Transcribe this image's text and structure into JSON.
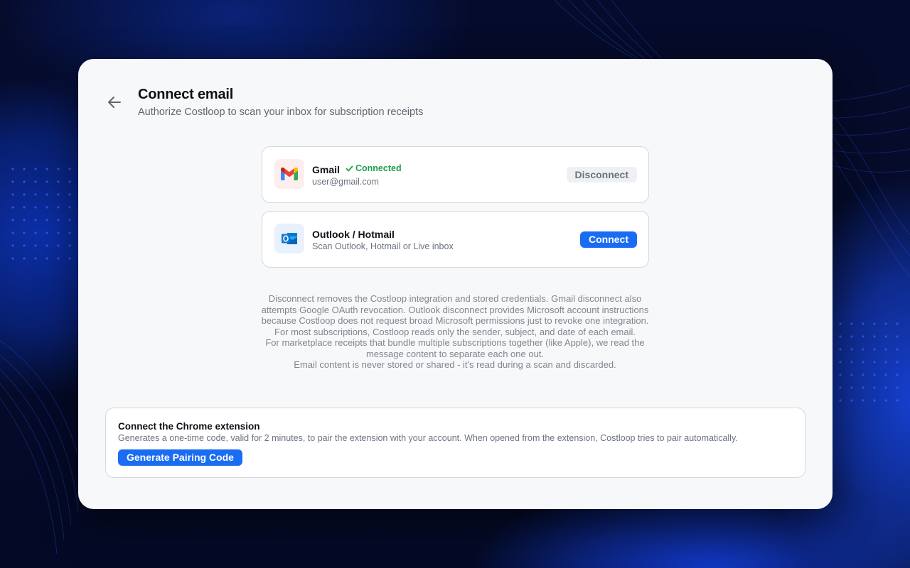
{
  "page": {
    "title": "Connect email",
    "subtitle": "Authorize Costloop to scan your inbox for subscription receipts",
    "back_icon": "arrow-left-icon"
  },
  "providers": [
    {
      "name": "Gmail",
      "icon": "gmail-icon",
      "status": "Connected",
      "status_color": "#1e9e4a",
      "subtext": "user@gmail.com",
      "action": "Disconnect"
    },
    {
      "name": "Outlook / Hotmail",
      "icon": "outlook-icon",
      "subtext": "Scan Outlook, Hotmail or Live inbox",
      "action": "Connect"
    }
  ],
  "disclaimer": [
    "Disconnect removes the Costloop integration and stored credentials. Gmail disconnect also attempts Google OAuth revocation. Outlook disconnect provides Microsoft account instructions because Costloop does not request broad Microsoft permissions just to revoke one integration.",
    "For most subscriptions, Costloop reads only the sender, subject, and date of each email.",
    "For marketplace receipts that bundle multiple subscriptions together (like Apple), we read the message content to separate each one out.",
    "Email content is never stored or shared - it's read during a scan and discarded."
  ],
  "extension": {
    "title": "Connect the Chrome extension",
    "description": "Generates a one-time code, valid for 2 minutes, to pair the extension with your account. When opened from the extension, Costloop tries to pair automatically.",
    "button": "Generate Pairing Code"
  },
  "colors": {
    "accent": "#1a6df2",
    "background": "#050d2e",
    "card": "#f7f8fa"
  }
}
